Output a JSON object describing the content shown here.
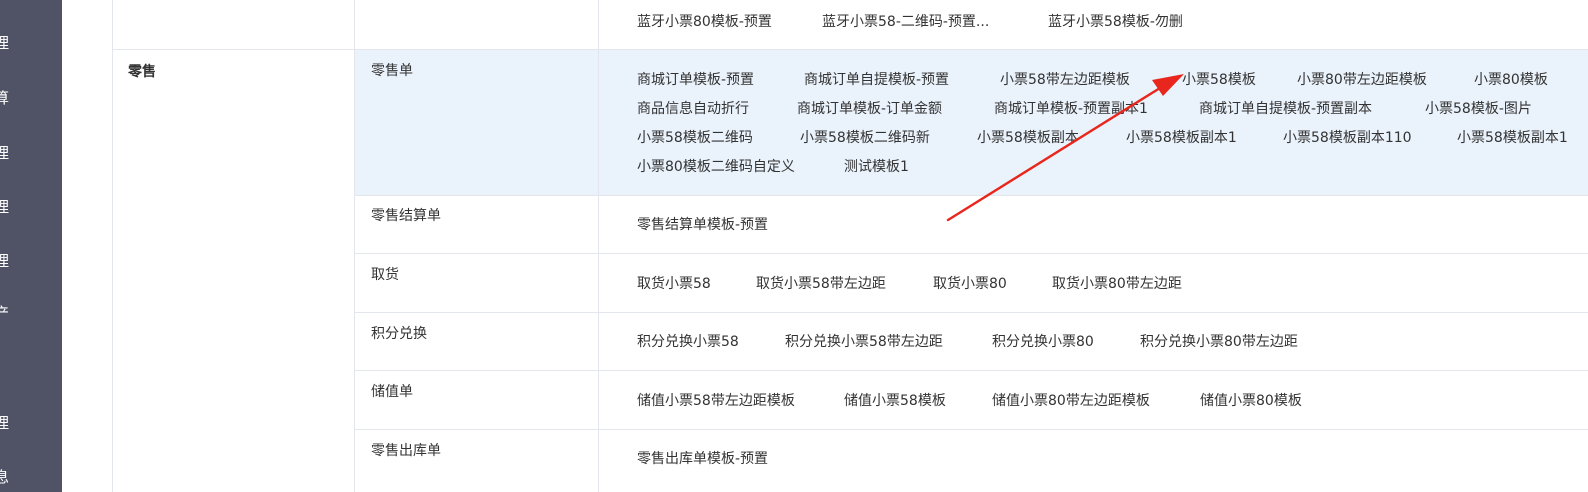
{
  "sidebar": {
    "items": [
      "理",
      "算",
      "理",
      "理",
      "理",
      "产",
      "理",
      "息"
    ]
  },
  "top_row": {
    "templates": [
      "蓝牙小票80模板-预置",
      "蓝牙小票58-二维码-预置...",
      "蓝牙小票58模板-勿删"
    ]
  },
  "category": {
    "label": "零售"
  },
  "rows": [
    {
      "label": "零售单",
      "templates": [
        "商城订单模板-预置",
        "商城订单自提模板-预置",
        "小票58带左边距模板",
        "小票58模板",
        "小票80带左边距模板",
        "小票80模板",
        "商品信息自动折行",
        "商城订单模板-订单金额",
        "商城订单模板-预置副本1",
        "商城订单自提模板-预置副本",
        "小票58模板-图片",
        "小票58模板二维码",
        "小票58模板二维码新",
        "小票58模板副本",
        "小票58模板副本1",
        "小票58模板副本110",
        "小票58模板副本1",
        "小票80模板二维码自定义",
        "测试模板1"
      ]
    },
    {
      "label": "零售结算单",
      "templates": [
        "零售结算单模板-预置"
      ]
    },
    {
      "label": "取货",
      "templates": [
        "取货小票58",
        "取货小票58带左边距",
        "取货小票80",
        "取货小票80带左边距"
      ]
    },
    {
      "label": "积分兑换",
      "templates": [
        "积分兑换小票58",
        "积分兑换小票58带左边距",
        "积分兑换小票80",
        "积分兑换小票80带左边距"
      ]
    },
    {
      "label": "储值单",
      "templates": [
        "储值小票58带左边距模板",
        "储值小票58模板",
        "储值小票80带左边距模板",
        "储值小票80模板"
      ]
    },
    {
      "label": "零售出库单",
      "templates": [
        "零售出库单模板-预置"
      ]
    }
  ],
  "colors": {
    "sidebar_bg": "#505366",
    "highlight_bg": "#eaf2fb",
    "arrow": "#e8261d"
  }
}
